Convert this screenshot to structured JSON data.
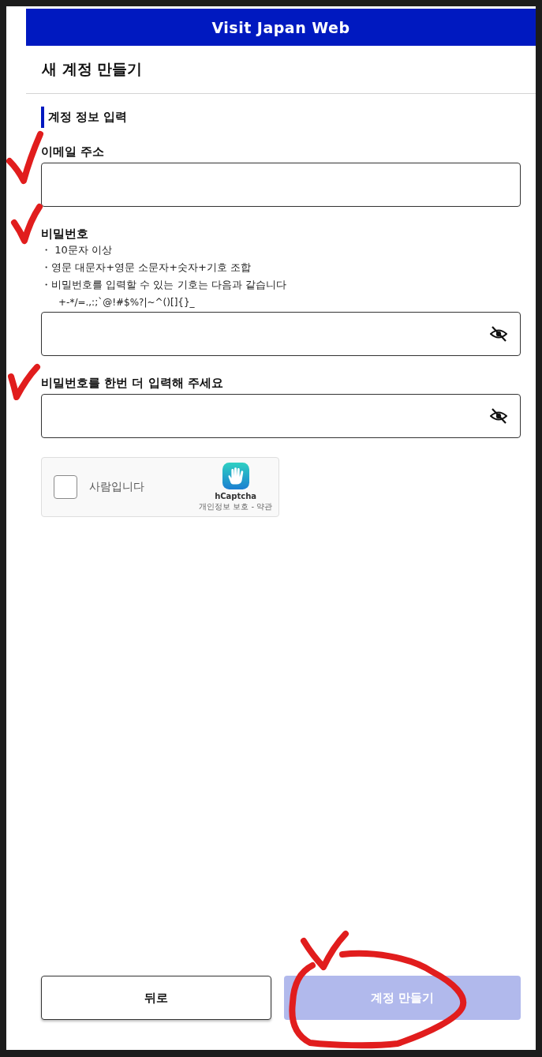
{
  "header": {
    "title": "Visit Japan Web"
  },
  "page_title": "새 계정 만들기",
  "section_title": "계정 정보 입력",
  "fields": [
    {
      "kind": "email",
      "label": "이메일 주소"
    },
    {
      "kind": "password",
      "label": "비밀번호",
      "masked": true,
      "hints": [
        "・ 10문자 이상",
        "・영문 대문자+영문 소문자+숫자+기호 조합",
        "・비밀번호를 입력할 수 있는 기호는 다음과 같습니다"
      ],
      "symbols": "+-*/=.,:;`@!#$%?|~^()[]{}_"
    },
    {
      "kind": "password",
      "label": "비밀번호를 한번 더 입력해 주세요",
      "masked": true
    }
  ],
  "captcha": {
    "label": "사람입니다",
    "checked": false,
    "brand": "hCaptcha",
    "links": [
      "개인정보 보호",
      "약관"
    ],
    "link_separator": "-"
  },
  "buttons": [
    {
      "kind": "secondary",
      "label": "뒤로",
      "disabled": false
    },
    {
      "kind": "primary",
      "label": "계정 만들기",
      "disabled": true
    }
  ]
}
